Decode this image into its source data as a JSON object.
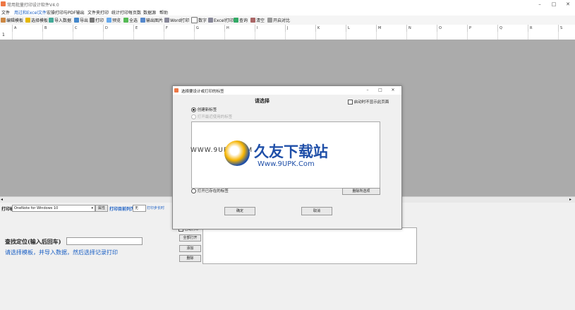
{
  "window": {
    "title": "常用批量打印设计软件V4.0",
    "minimize": "–",
    "maximize": "□",
    "close": "✕"
  },
  "menu": [
    "文件",
    "用过和Excel文件",
    "宏操打印与PDF输出",
    "文件夹打印",
    "统计打印每页数",
    "数据源",
    "帮助"
  ],
  "toolbar": [
    "编辑模板",
    "选择模板",
    "导入数据",
    "导出",
    "打印",
    "预览",
    "全选",
    "输出图片",
    "Word打印",
    "数字",
    "Excel打印",
    "查询",
    "清空",
    "开启对比"
  ],
  "grid": {
    "columns": [
      "A",
      "B",
      "C",
      "D",
      "E",
      "F",
      "G",
      "H",
      "I",
      "J",
      "K",
      "L",
      "M",
      "N",
      "O",
      "P",
      "Q",
      "R",
      "S"
    ],
    "row_num": "1"
  },
  "bottom": {
    "printer_label": "打印机",
    "printer_value": "OneNote for Windows 10",
    "props_btn": "属性",
    "print_label": "打印目前列为",
    "print_value": "无",
    "print_step_label": "打印步长时",
    "search_label": "查找定位(输入后回车)",
    "hint": "请选择模板，并导入数据，然后选择记录打印",
    "side_check": "自动打印",
    "side_btns": [
      "全部打开",
      "添加",
      "删除"
    ]
  },
  "dialog": {
    "title": "选择要设计或打印的标签",
    "heading": "请选择",
    "dont_show": "启动时不显示此页面",
    "radio_new": "创建新标签",
    "radio_recent": "打开最近使用的标签",
    "radio_open": "打开已存在的标签",
    "clear_btn": "删除所选项",
    "ok": "确定",
    "cancel": "取消"
  },
  "watermark": {
    "url": "WWW.9UPK.COM",
    "name": "久友下载站",
    "sub": "Www.9UPK.Com"
  },
  "colors": {
    "accent": "#1a5fc4",
    "work": "#ababab"
  }
}
